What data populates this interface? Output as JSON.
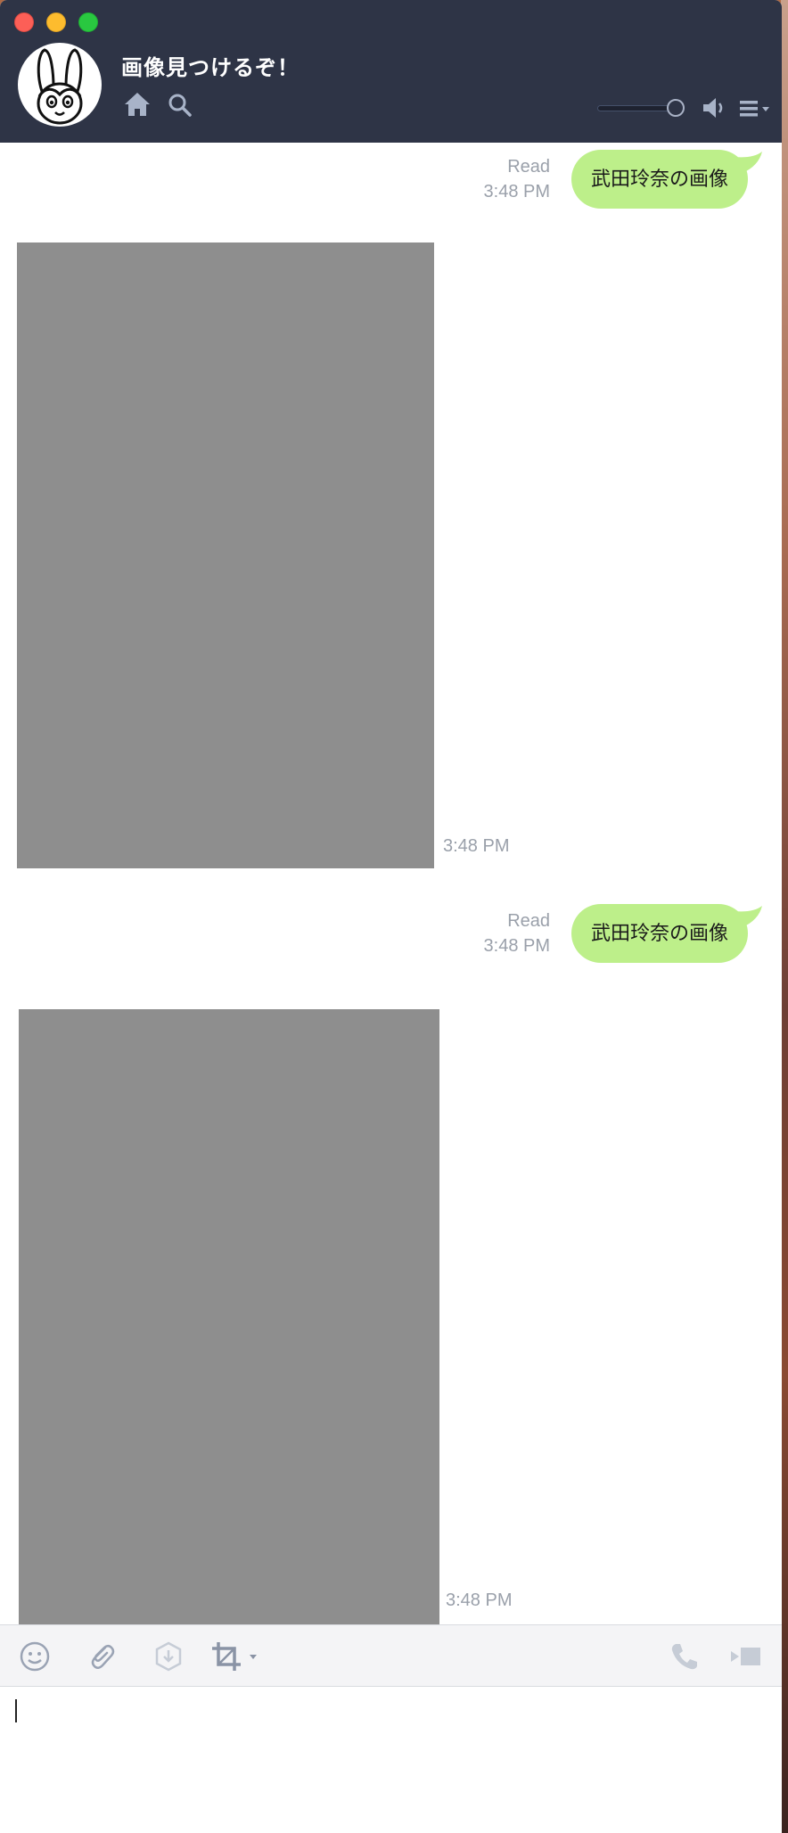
{
  "window": {
    "title": "画像見つけるぞ！"
  },
  "messages": [
    {
      "type": "outgoing-text",
      "read": "Read",
      "time": "3:48 PM",
      "text": "武田玲奈の画像"
    },
    {
      "type": "incoming-image",
      "time": "3:48 PM"
    },
    {
      "type": "outgoing-text",
      "read": "Read",
      "time": "3:48 PM",
      "text": "武田玲奈の画像"
    },
    {
      "type": "incoming-image",
      "time": "3:48 PM"
    }
  ],
  "header_icons": [
    "home-icon",
    "search-icon",
    "volume-slider",
    "speaker-icon",
    "menu-icon"
  ],
  "toolbar_icons": [
    "emoji-icon",
    "attach-icon",
    "keep-icon",
    "screenshot-icon",
    "call-icon",
    "video-call-icon"
  ],
  "input": {
    "value": ""
  },
  "colors": {
    "header": "#2e3446",
    "bubble": "#bdef8a",
    "image_placeholder": "#8e8e8e"
  }
}
